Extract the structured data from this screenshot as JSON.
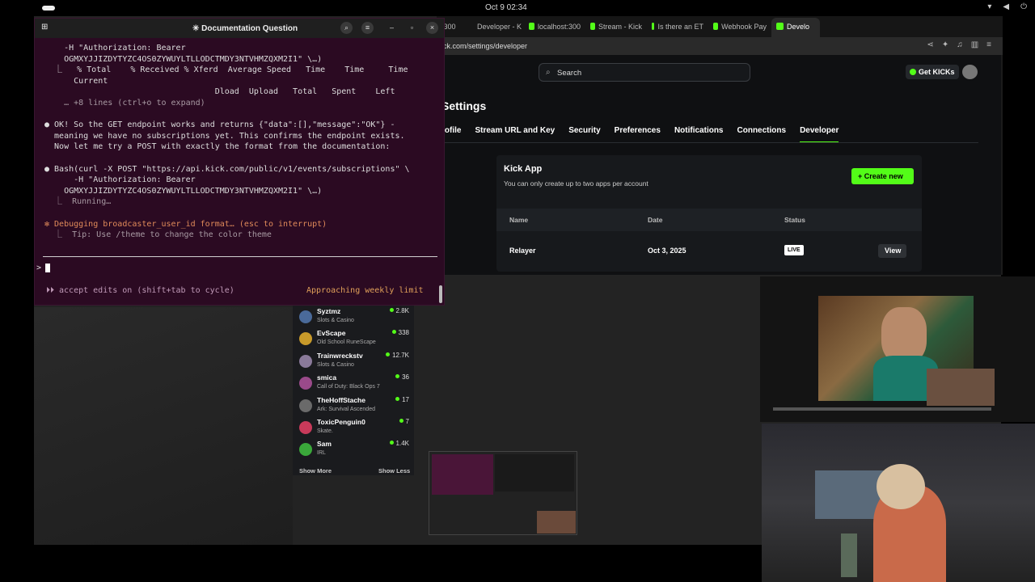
{
  "system_bar": {
    "datetime": "Oct 9  02:34"
  },
  "browser": {
    "tabs": [
      {
        "label": ":300"
      },
      {
        "label": "Developer - K"
      },
      {
        "label": "localhost:300"
      },
      {
        "label": "Stream - Kick"
      },
      {
        "label": "Is there an ET"
      },
      {
        "label": "Webhook Pay"
      },
      {
        "label": "Develo"
      }
    ],
    "url": "ck.com/settings/developer",
    "search_placeholder": "Search",
    "get_kicks_label": "Get KICKs",
    "settings_title": "Settings",
    "settings_tabs": [
      "rofile",
      "Stream URL and Key",
      "Security",
      "Preferences",
      "Notifications",
      "Connections",
      "Developer"
    ],
    "app_card": {
      "title": "Kick App",
      "subtitle": "You can only create up to two apps per account",
      "create_label": "Create new",
      "columns": [
        "Name",
        "Date",
        "Status"
      ],
      "rows": [
        {
          "name": "Relayer",
          "date": "Oct 3, 2025",
          "status": "LIVE",
          "action": "View"
        }
      ]
    },
    "accent_color": "#53fc18"
  },
  "terminal": {
    "title": "Documentation Question",
    "lines": [
      "    -H \"Authorization: Bearer",
      "    OGMXYJJIZDYTYZC4OS0ZYWUYLTLLODCTMDY3NTVHMZQXM2I1\" \\…)",
      "  ⎿   % Total    % Received % Xferd  Average Speed   Time    Time     Time",
      "      Current",
      "                                   Dload  Upload   Total   Spent    Left",
      "    … +8 lines (ctrl+o to expand)",
      "",
      "● OK! So the GET endpoint works and returns {\"data\":[],\"message\":\"OK\"} -",
      "  meaning we have no subscriptions yet. This confirms the endpoint exists.",
      "  Now let me try a POST with exactly the format from the documentation:",
      "",
      "● Bash(curl -X POST \"https://api.kick.com/public/v1/events/subscriptions\" \\",
      "      -H \"Authorization: Bearer",
      "    OGMXYJJIZDYTYZC4OS0ZYWUYLTLLODCTMDY3NTVHMZQXM2I1\" \\…)",
      "  ⎿  Running…",
      "",
      "✻ Debugging broadcaster_user_id format… (esc to interrupt)",
      "  ⎿  Tip: Use /theme to change the color theme"
    ],
    "prompt_symbol": ">",
    "status_left": "⏵⏵ accept edits on (shift+tab to cycle)",
    "status_right": "Approaching weekly limit"
  },
  "streamers": [
    {
      "name": "Syztmz",
      "category": "Slots & Casino",
      "viewers": "2.8K",
      "color": "#4a6a9a"
    },
    {
      "name": "EvScape",
      "category": "Old School RuneScape",
      "viewers": "338",
      "color": "#c89a2a"
    },
    {
      "name": "Trainwreckstv",
      "category": "Slots & Casino",
      "viewers": "12.7K",
      "color": "#8a7a9a"
    },
    {
      "name": "smica",
      "category": "Call of Duty: Black Ops 7",
      "viewers": "36",
      "color": "#9a4a8a"
    },
    {
      "name": "TheHoffStache",
      "category": "Ark: Survival Ascended",
      "viewers": "17",
      "color": "#6a6a6a"
    },
    {
      "name": "ToxicPenguin0",
      "category": "Skate.",
      "viewers": "7",
      "color": "#c83a5a"
    },
    {
      "name": "Sam",
      "category": "IRL",
      "viewers": "1.4K",
      "color": "#3aa83a"
    }
  ],
  "show_more_label": "Show More",
  "show_less_label": "Show Less"
}
